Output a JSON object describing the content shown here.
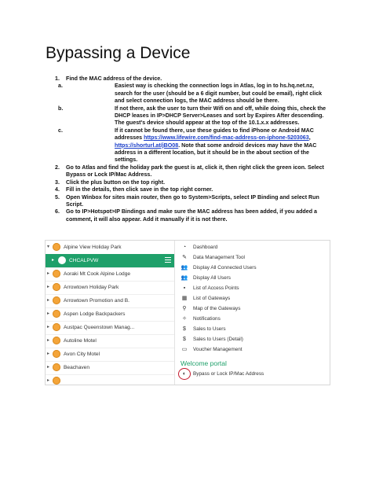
{
  "title": "Bypassing a Device",
  "steps": [
    {
      "num": "1.",
      "text": "Find the MAC address of the device.",
      "substeps": [
        {
          "letter": "a.",
          "text": "Easiest way is checking the connection logs in Atlas, log in to hs.hq.net.nz, search for the user (should be a 6 digit number, but could be email), right click and select connection logs, the MAC address should be there."
        },
        {
          "letter": "b.",
          "text": "If not there, ask the user to turn their Wifi on and off, while doing this, check the DHCP leases in IP>DHCP Server>Leases and sort by Expires After descending. The guest's device should appear at the top of the 10.1.x.x addresses."
        },
        {
          "letter": "c.",
          "text_before": "If it cannot be found there, use these guides to find iPhone or Android MAC addresses ",
          "link1": "https://www.lifewire.com/find-mac-address-on-iphone-5203063",
          "text_mid": ", ",
          "link2": "https://shorturl.at/jBO08",
          "text_after": ". Note that some android devices may have the MAC address in a different location, but it should be in the about section of the settings."
        }
      ]
    },
    {
      "num": "2.",
      "text": "Go to Atlas and find the holiday park the guest is at, click it, then right click the green icon. Select Bypass or Lock IP/Mac Address."
    },
    {
      "num": "3.",
      "text": "Click the plus button on the top right."
    },
    {
      "num": "4.",
      "text": "Fill in the details, then click save in the top right corner."
    },
    {
      "num": "5.",
      "text": "Open Winbox for sites main router, then go to System>Scripts, select IP Binding and select Run Script."
    },
    {
      "num": "6.",
      "text": "Go to IP>Hotspot>IP Bindings and make sure the MAC address has been added, if you added a comment, it will also appear. Add it manually if it is not there."
    }
  ],
  "screenshot": {
    "tree": [
      {
        "label": "Alpine View Holiday Park",
        "selected": false
      },
      {
        "label": "CHCALPVW",
        "selected": true
      },
      {
        "label": "Aoraki Mt Cook Alpine Lodge",
        "selected": false
      },
      {
        "label": "Arrowtown Holiday Park",
        "selected": false
      },
      {
        "label": "Arrowtown Promotion and B.",
        "selected": false
      },
      {
        "label": "Aspen Lodge Backpackers",
        "selected": false
      },
      {
        "label": "Austpac Queenstown Manag...",
        "selected": false
      },
      {
        "label": "Autoline Motel",
        "selected": false
      },
      {
        "label": "Avon City Motel",
        "selected": false
      },
      {
        "label": "Beachaven",
        "selected": false
      }
    ],
    "menu": [
      {
        "icon": "dashboard-icon",
        "glyph": "◔",
        "label": "Dashboard"
      },
      {
        "icon": "wrench-icon",
        "glyph": "✎",
        "label": "Data Management Tool"
      },
      {
        "icon": "users-icon",
        "glyph": "👥",
        "label": "Display All Connected Users"
      },
      {
        "icon": "users-icon",
        "glyph": "👥",
        "label": "Display All Users"
      },
      {
        "icon": "access-point-icon",
        "glyph": "▪",
        "label": "List of Access Points"
      },
      {
        "icon": "gateway-icon",
        "glyph": "▦",
        "label": "List of Gateways"
      },
      {
        "icon": "map-icon",
        "glyph": "⚲",
        "label": "Map of the Gateways"
      },
      {
        "icon": "bell-icon",
        "glyph": "✧",
        "label": "Notifications"
      },
      {
        "icon": "dollar-icon",
        "glyph": "$",
        "label": "Sales to Users"
      },
      {
        "icon": "dollar-icon",
        "glyph": "$",
        "label": "Sales to Users (Detail)"
      },
      {
        "icon": "voucher-icon",
        "glyph": "▭",
        "label": "Voucher Management"
      }
    ],
    "section_title": "Welcome portal",
    "bypass_item": {
      "icon": "bypass-icon",
      "glyph": "◐",
      "label": "Bypass or Lock IP/Mac Address"
    }
  }
}
